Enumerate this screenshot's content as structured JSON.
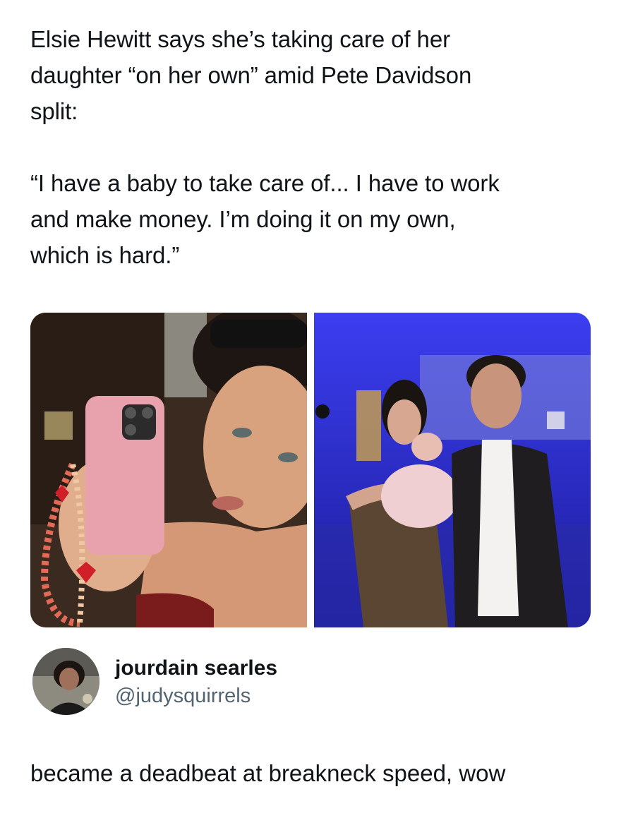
{
  "quoted_tweet": {
    "text": "Elsie Hewitt says she’s taking care of her\ndaughter “on her own” amid Pete Davidson\nsplit:",
    "quote": "“I have a baby to take care of... I have to work\nand make money. I’m doing it on my own,\nwhich is hard.”",
    "media": [
      {
        "icon": "selfie-photo",
        "description_name": "mirror-selfie-photo"
      },
      {
        "icon": "couple-with-baby-photo",
        "description_name": "couple-with-baby-photo"
      }
    ]
  },
  "reply": {
    "display_name": "jourdain searles",
    "handle": "@judysquirrels",
    "text": "became a deadbeat at breakneck speed, wow"
  },
  "colors": {
    "text_primary": "#0f1419",
    "text_secondary": "#536471",
    "background": "#ffffff"
  }
}
